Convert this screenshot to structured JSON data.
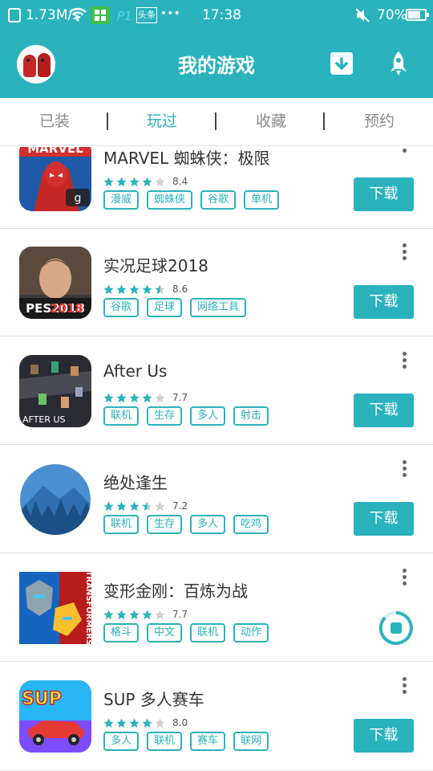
{
  "status_bar": {
    "network_speed": "1.73M/s",
    "toutiao_label": "头条",
    "dots": "•••",
    "time": "17:38",
    "battery": "70%"
  },
  "header": {
    "title": "我的游戏"
  },
  "tabs": [
    {
      "label": "已装"
    },
    {
      "label": "玩过"
    },
    {
      "label": "收藏"
    },
    {
      "label": "预约"
    }
  ],
  "active_tab": "玩过",
  "colors": {
    "accent": "#2ab3bd",
    "text": "#333333",
    "tab_inactive": "#8a8a8a",
    "star_empty": "#cfcfcf"
  },
  "games": [
    {
      "name": "MARVEL 蜘蛛侠：极限",
      "score": "8.4",
      "stars": 4.0,
      "tags": [
        "漫威",
        "蜘蛛侠",
        "谷歌",
        "单机"
      ],
      "action": "下载",
      "icon": "spiderman-icon"
    },
    {
      "name": "实况足球2018",
      "score": "8.6",
      "stars": 4.5,
      "tags": [
        "谷歌",
        "足球",
        "网络工具"
      ],
      "action": "下载",
      "icon": "pes2018-icon"
    },
    {
      "name": "After Us",
      "score": "7.7",
      "stars": 4.0,
      "tags": [
        "联机",
        "生存",
        "多人",
        "射击"
      ],
      "action": "下载",
      "icon": "after-us-icon"
    },
    {
      "name": "绝处逢生",
      "score": "7.2",
      "stars": 3.5,
      "tags": [
        "联机",
        "生存",
        "多人",
        "吃鸡"
      ],
      "action": "下载",
      "icon": "mountain-forest-icon"
    },
    {
      "name": "变形金刚：百炼为战",
      "score": "7.7",
      "stars": 4.0,
      "tags": [
        "格斗",
        "中文",
        "联机",
        "动作"
      ],
      "action": "downloading",
      "icon": "transformers-icon"
    },
    {
      "name": "SUP 多人赛车",
      "score": "8.0",
      "stars": 4.0,
      "tags": [
        "多人",
        "联机",
        "赛车",
        "联网"
      ],
      "action": "下载",
      "icon": "sup-racing-icon"
    }
  ]
}
